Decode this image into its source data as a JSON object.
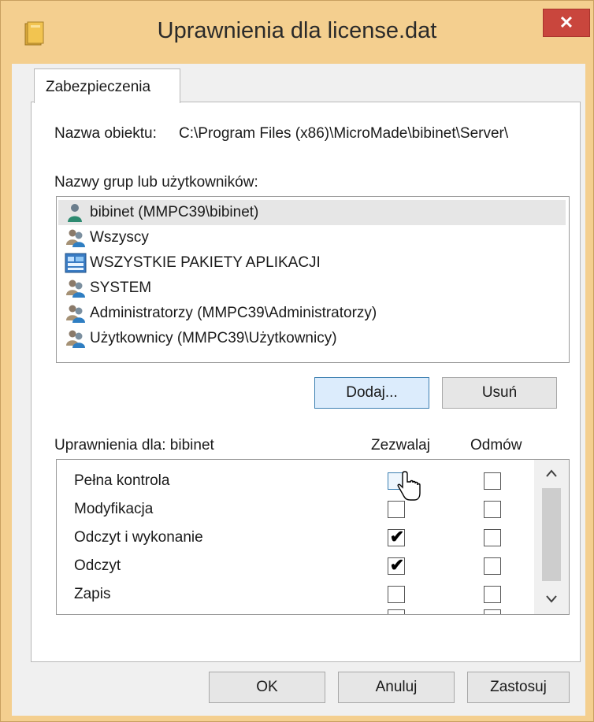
{
  "window": {
    "title": "Uprawnienia dla license.dat",
    "close_label": "✕"
  },
  "tabs": [
    {
      "label": "Zabezpieczenia",
      "active": true
    }
  ],
  "object_name": {
    "label": "Nazwa obiektu:",
    "value": "C:\\Program Files (x86)\\MicroMade\\bibinet\\Server\\"
  },
  "groups": {
    "label": "Nazwy grup lub użytkowników:",
    "items": [
      {
        "label": "bibinet (MMPC39\\bibinet)",
        "icon": "user-icon",
        "selected": true
      },
      {
        "label": "Wszyscy",
        "icon": "group-icon",
        "selected": false
      },
      {
        "label": "WSZYSTKIE PAKIETY APLIKACJI",
        "icon": "app-packages-icon",
        "selected": false
      },
      {
        "label": "SYSTEM",
        "icon": "group-icon",
        "selected": false
      },
      {
        "label": "Administratorzy (MMPC39\\Administratorzy)",
        "icon": "group-icon",
        "selected": false
      },
      {
        "label": "Użytkownicy (MMPC39\\Użytkownicy)",
        "icon": "group-icon",
        "selected": false
      }
    ]
  },
  "buttons": {
    "add": "Dodaj...",
    "remove": "Usuń",
    "ok": "OK",
    "cancel": "Anuluj",
    "apply": "Zastosuj"
  },
  "permissions": {
    "label": "Uprawnienia dla: bibinet",
    "allow_header": "Zezwalaj",
    "deny_header": "Odmów",
    "rows": [
      {
        "label": "Pełna kontrola",
        "allow": false,
        "deny": false
      },
      {
        "label": "Modyfikacja",
        "allow": false,
        "deny": false
      },
      {
        "label": "Odczyt i wykonanie",
        "allow": true,
        "deny": false
      },
      {
        "label": "Odczyt",
        "allow": true,
        "deny": false
      },
      {
        "label": "Zapis",
        "allow": false,
        "deny": false
      }
    ]
  },
  "colors": {
    "titlebar": "#f4cf8f",
    "close_button": "#c9463d",
    "focus_button": "#dcecfc",
    "selection": "#e6e6e6"
  }
}
